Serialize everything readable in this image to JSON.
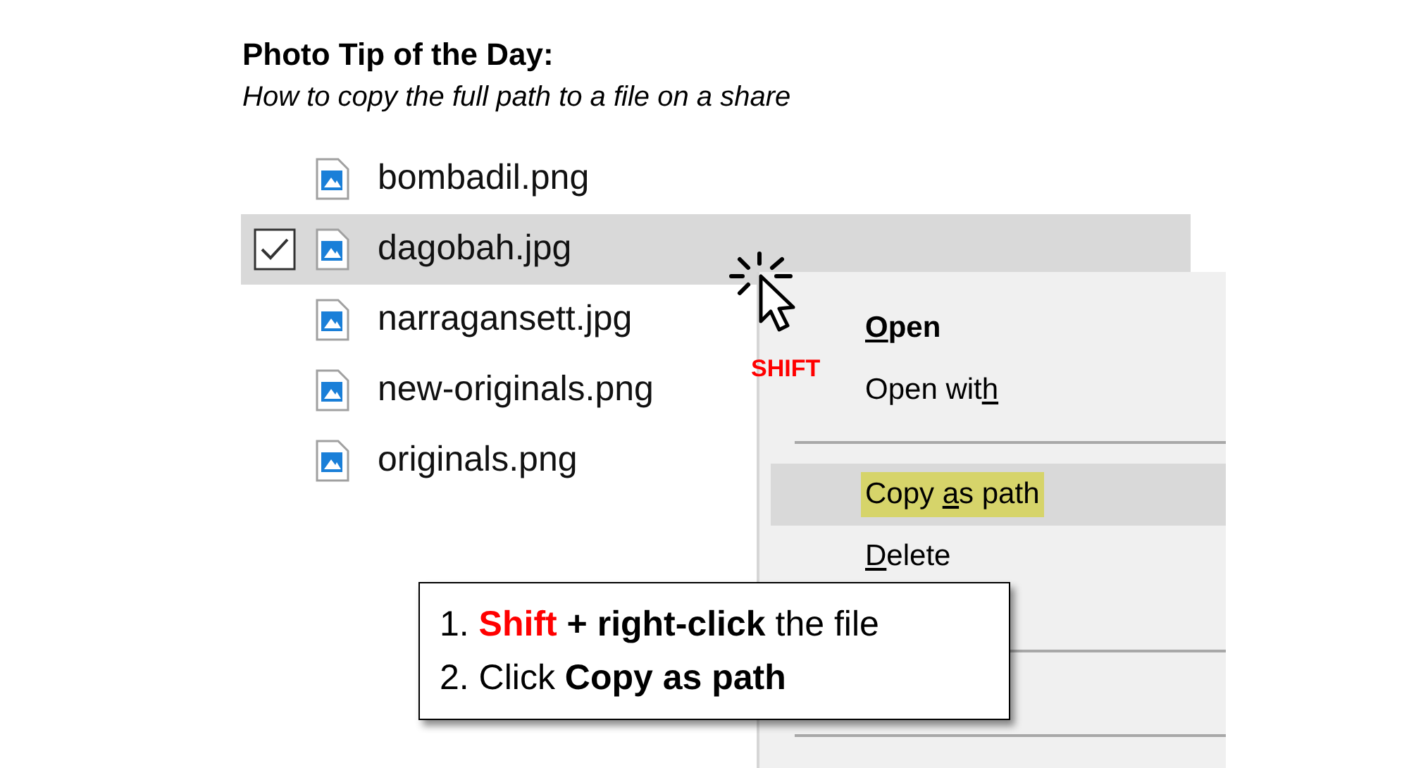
{
  "title": "Photo Tip of the Day:",
  "subtitle": "How to copy the full path to a file on a share",
  "files": [
    {
      "name": "bombadil.png",
      "selected": false
    },
    {
      "name": "dagobah.jpg",
      "selected": true
    },
    {
      "name": "narragansett.jpg",
      "selected": false
    },
    {
      "name": "new-originals.png",
      "selected": false
    },
    {
      "name": "originals.png",
      "selected": false
    }
  ],
  "cursor_label": "SHIFT",
  "context_menu": [
    {
      "kind": "item",
      "access_key": "O",
      "after": "pen",
      "bold": true,
      "selected": false,
      "highlighted": false
    },
    {
      "kind": "item",
      "before": "Open wit",
      "access_key": "h",
      "bold": false,
      "selected": false,
      "highlighted": false
    },
    {
      "kind": "separator"
    },
    {
      "kind": "item",
      "before": "Copy ",
      "access_key": "a",
      "after": "s path",
      "bold": false,
      "selected": true,
      "highlighted": true
    },
    {
      "kind": "item",
      "access_key": "D",
      "after": "elete",
      "bold": false,
      "selected": false,
      "highlighted": false
    },
    {
      "kind": "gap"
    },
    {
      "kind": "separator"
    },
    {
      "kind": "gap"
    },
    {
      "kind": "separator"
    }
  ],
  "callout": [
    [
      {
        "kind": "text",
        "text": "1. "
      },
      {
        "kind": "key",
        "text": "Shift"
      },
      {
        "kind": "action",
        "text": " + right-click"
      },
      {
        "kind": "text",
        "text": " the file"
      }
    ],
    [
      {
        "kind": "text",
        "text": "2. Click "
      },
      {
        "kind": "action",
        "text": "Copy as path"
      }
    ]
  ]
}
